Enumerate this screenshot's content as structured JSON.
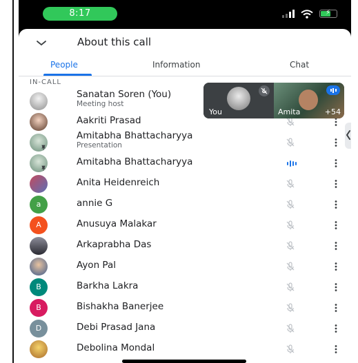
{
  "status_bar": {
    "time": "8:17",
    "battery_color": "#31c85a"
  },
  "header": {
    "collapse_icon": "chevron-down-icon",
    "title": "About this call"
  },
  "tabs": [
    {
      "label": "People",
      "active": true
    },
    {
      "label": "Information",
      "active": false
    },
    {
      "label": "Chat",
      "active": false
    }
  ],
  "section_label": "IN-CALL",
  "participants": [
    {
      "name": "Sanatan Soren (You)",
      "sub": "Meeting host",
      "avatar": "photo",
      "letter": "",
      "color": "",
      "mic": "none",
      "pinned": false
    },
    {
      "name": "Aakriti Prasad",
      "sub": "",
      "avatar": "photo",
      "letter": "",
      "color": "",
      "mic": "muted",
      "pinned": false
    },
    {
      "name": "Amitabha Bhattacharyya",
      "sub": "Presentation",
      "avatar": "photo",
      "letter": "",
      "color": "",
      "mic": "muted",
      "pinned": true
    },
    {
      "name": "Amitabha Bhattacharyya",
      "sub": "",
      "avatar": "photo",
      "letter": "",
      "color": "",
      "mic": "speaking",
      "pinned": true
    },
    {
      "name": "Anita Heidenreich",
      "sub": "",
      "avatar": "photo",
      "letter": "",
      "color": "",
      "mic": "muted",
      "pinned": false
    },
    {
      "name": "annie G",
      "sub": "",
      "avatar": "letter",
      "letter": "a",
      "color": "#43a047",
      "mic": "muted",
      "pinned": false
    },
    {
      "name": "Anusuya Malakar",
      "sub": "",
      "avatar": "letter",
      "letter": "A",
      "color": "#f4511e",
      "mic": "muted",
      "pinned": false
    },
    {
      "name": "Arkaprabha Das",
      "sub": "",
      "avatar": "photo",
      "letter": "",
      "color": "",
      "mic": "muted",
      "pinned": false
    },
    {
      "name": "Ayon Pal",
      "sub": "",
      "avatar": "photo",
      "letter": "",
      "color": "",
      "mic": "muted",
      "pinned": false
    },
    {
      "name": "Barkha Lakra",
      "sub": "",
      "avatar": "letter",
      "letter": "B",
      "color": "#00897b",
      "mic": "muted",
      "pinned": false
    },
    {
      "name": "Bishakha Banerjee",
      "sub": "",
      "avatar": "letter",
      "letter": "B",
      "color": "#d81b60",
      "mic": "muted",
      "pinned": false
    },
    {
      "name": "Debi Prasad Jana",
      "sub": "",
      "avatar": "letter",
      "letter": "D",
      "color": "#78909c",
      "mic": "muted",
      "pinned": false
    },
    {
      "name": "Debolina Mondal",
      "sub": "",
      "avatar": "photo",
      "letter": "",
      "color": "",
      "mic": "muted",
      "pinned": false
    }
  ],
  "pip": {
    "self_label": "You",
    "other_label": "Amita",
    "others_count": "+54"
  },
  "colors": {
    "accent": "#1a73e8",
    "text": "#202124",
    "secondary": "#5f6368"
  }
}
